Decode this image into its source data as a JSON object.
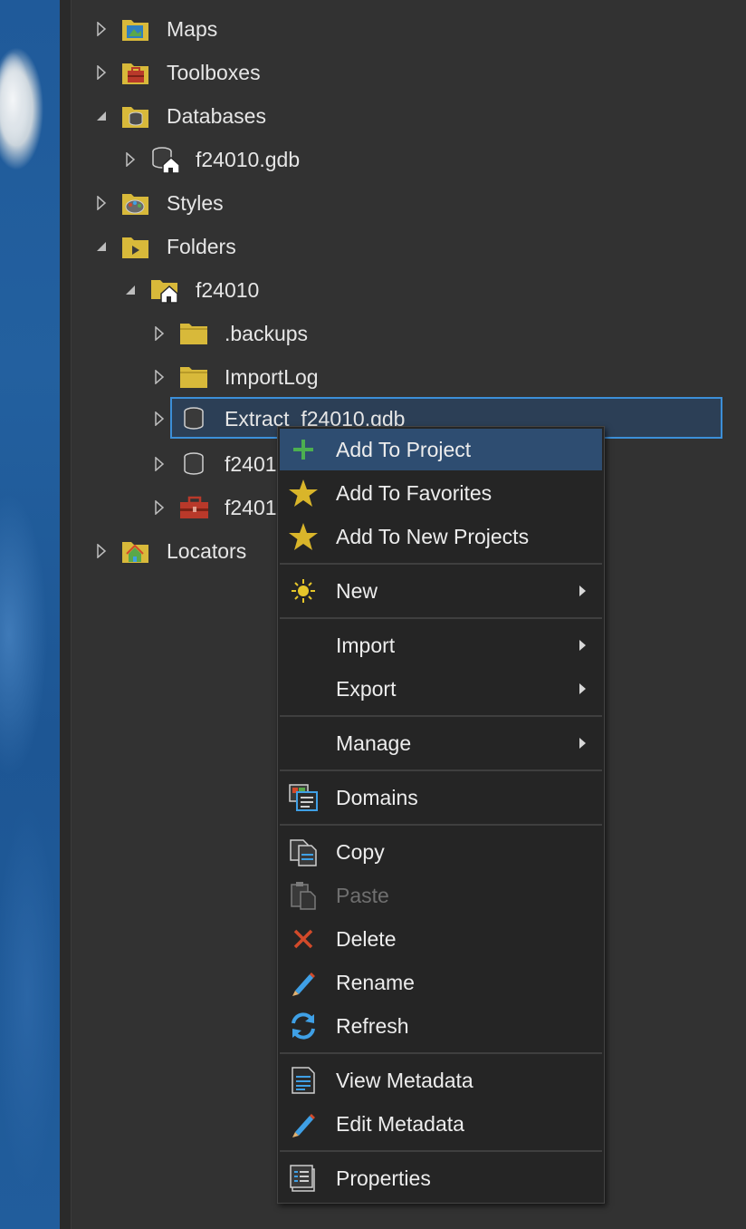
{
  "tree": {
    "items": [
      {
        "label": "Maps",
        "icon": "maps-folder-icon",
        "expanded": false
      },
      {
        "label": "Toolboxes",
        "icon": "toolboxes-folder-icon",
        "expanded": false
      },
      {
        "label": "Databases",
        "icon": "databases-folder-icon",
        "expanded": true
      },
      {
        "label": "f24010.gdb",
        "icon": "home-geodatabase-icon",
        "expanded": false
      },
      {
        "label": "Styles",
        "icon": "styles-folder-icon",
        "expanded": false
      },
      {
        "label": "Folders",
        "icon": "folders-folder-icon",
        "expanded": true
      },
      {
        "label": "f24010",
        "icon": "home-folder-icon",
        "expanded": true
      },
      {
        "label": ".backups",
        "icon": "folder-icon",
        "expanded": false
      },
      {
        "label": "ImportLog",
        "icon": "folder-icon",
        "expanded": false
      },
      {
        "label": "Extract_f24010.gdb",
        "icon": "geodatabase-icon",
        "expanded": false,
        "selected": true
      },
      {
        "label": "f2401",
        "icon": "geodatabase-icon",
        "expanded": false
      },
      {
        "label": "f2401",
        "icon": "toolbox-icon",
        "expanded": false
      },
      {
        "label": "Locators",
        "icon": "locators-folder-icon",
        "expanded": false
      }
    ]
  },
  "context_menu": {
    "items": [
      {
        "label": "Add To Project",
        "icon": "plus-icon",
        "highlighted": true
      },
      {
        "label": "Add To Favorites",
        "icon": "star-icon"
      },
      {
        "label": "Add To New Projects",
        "icon": "star-icon"
      },
      {
        "label": "New",
        "icon": "sun-icon",
        "submenu": true
      },
      {
        "label": "Import",
        "submenu": true
      },
      {
        "label": "Export",
        "submenu": true
      },
      {
        "label": "Manage",
        "submenu": true
      },
      {
        "label": "Domains",
        "icon": "domains-icon"
      },
      {
        "label": "Copy",
        "icon": "copy-icon"
      },
      {
        "label": "Paste",
        "icon": "paste-icon",
        "disabled": true
      },
      {
        "label": "Delete",
        "icon": "delete-x-icon"
      },
      {
        "label": "Rename",
        "icon": "pencil-icon"
      },
      {
        "label": "Refresh",
        "icon": "refresh-icon"
      },
      {
        "label": "View Metadata",
        "icon": "metadata-icon"
      },
      {
        "label": "Edit Metadata",
        "icon": "pencil-icon"
      },
      {
        "label": "Properties",
        "icon": "properties-icon"
      }
    ]
  },
  "colors": {
    "background": "#323232",
    "menu_bg": "#252525",
    "highlight": "#2e4d71",
    "selection_border": "#3c8fd8",
    "folder_yellow": "#d8b93a",
    "star_gold": "#d9b52a",
    "delete_red": "#d24a2a",
    "accent_blue": "#3fa0e6"
  }
}
